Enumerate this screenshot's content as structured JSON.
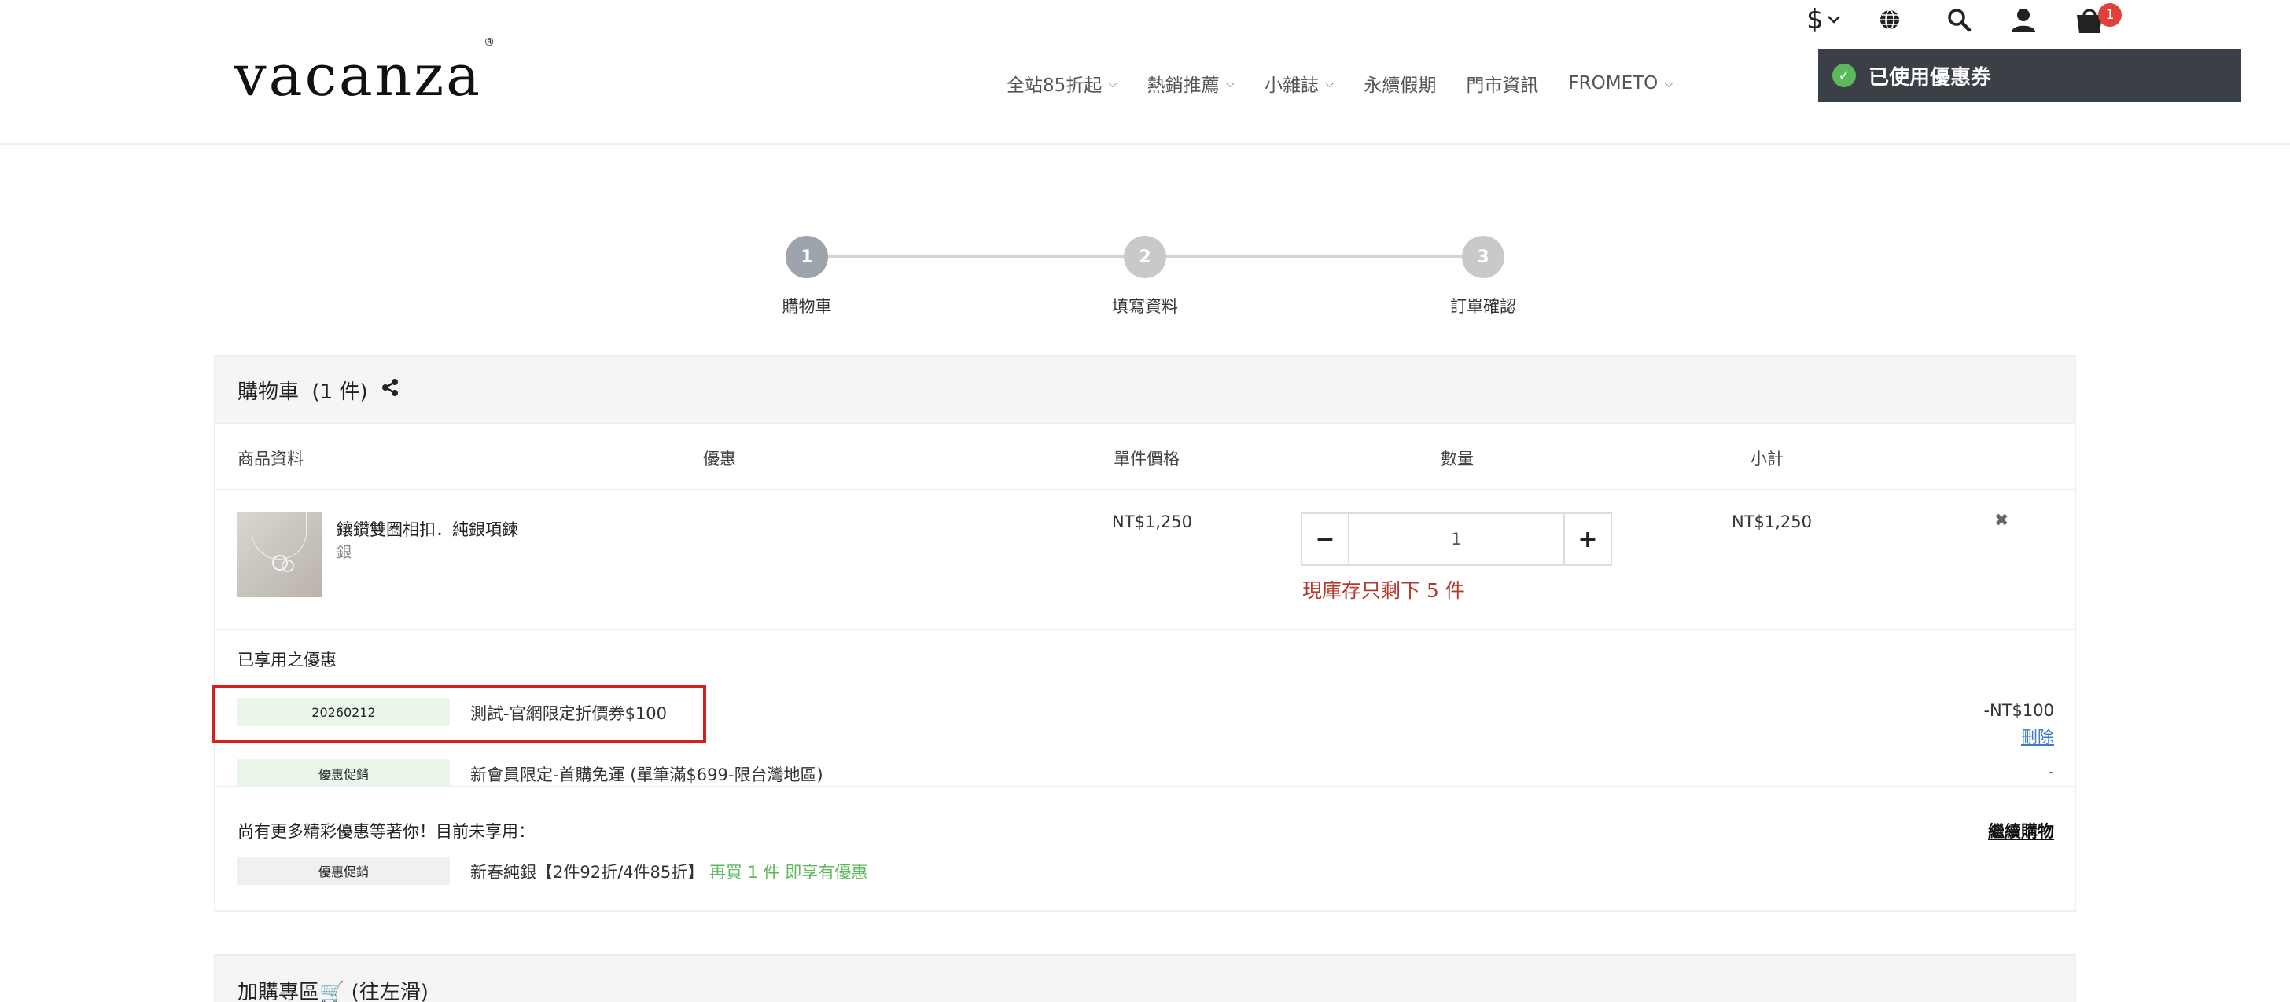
{
  "header": {
    "logo": "vacanza",
    "logo_mark": "®",
    "nav": [
      {
        "label": "全站85折起",
        "has_dropdown": true
      },
      {
        "label": "熱銷推薦",
        "has_dropdown": true
      },
      {
        "label": "小雜誌",
        "has_dropdown": true
      },
      {
        "label": "永續假期",
        "has_dropdown": false
      },
      {
        "label": "門市資訊",
        "has_dropdown": false
      },
      {
        "label": "FROMETO",
        "has_dropdown": true
      }
    ],
    "currency_symbol": "$",
    "cart_count": "1",
    "icons": [
      "currency-icon",
      "globe-icon",
      "search-icon",
      "user-icon",
      "cart-icon"
    ]
  },
  "toast": {
    "message": "已使用優惠券",
    "color": "#3b3f46",
    "icon": "check-circle-icon"
  },
  "steps": [
    {
      "number": "1",
      "label": "購物車",
      "active": true
    },
    {
      "number": "2",
      "label": "填寫資料",
      "active": false
    },
    {
      "number": "3",
      "label": "訂單確認",
      "active": false
    }
  ],
  "cart": {
    "title": "購物車",
    "count_text": "(1 件)",
    "columns": {
      "product": "商品資料",
      "discount": "優惠",
      "unit_price": "單件價格",
      "quantity": "數量",
      "subtotal": "小計"
    },
    "items": [
      {
        "name": "鑲鑽雙圈相扣．純銀項鍊",
        "variant": "銀",
        "unit_price": "NT$1,250",
        "quantity": "1",
        "stock_warning": "現庫存只剩下 5 件",
        "subtotal": "NT$1,250"
      }
    ],
    "applied": {
      "title": "已享用之優惠",
      "entries": [
        {
          "tag": "20260212",
          "text": "測試-官網限定折價券$100",
          "amount": "-NT$100",
          "action": "刪除"
        },
        {
          "tag": "優惠促銷",
          "text": "新會員限定-首購免運 (單筆滿$699-限台灣地區)",
          "amount": "-"
        }
      ]
    },
    "more": {
      "title": "尚有更多精彩優惠等著你！目前未享用：",
      "continue_label": "繼續購物",
      "entries": [
        {
          "tag": "優惠促銷",
          "text": "新春純銀【2件92折/4件85折】",
          "hint": "再買 1 件 即享有優惠"
        }
      ]
    }
  },
  "addon": {
    "title": "加購專區🛒 (往左滑)"
  },
  "colors": {
    "accent_red": "#d61e1e",
    "stock_red": "#b53a2e",
    "link_blue": "#3b7bc9",
    "promo_green": "#5cb85c",
    "badge_red": "#e0403b",
    "step_active": "#9ea4ab",
    "step_inactive": "#c9c9c9"
  }
}
